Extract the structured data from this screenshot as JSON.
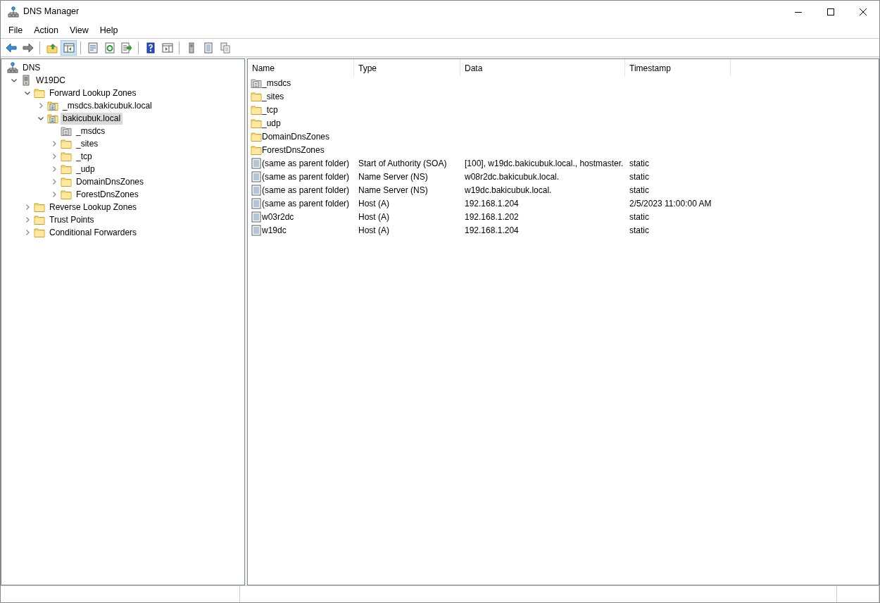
{
  "window": {
    "title": "DNS Manager"
  },
  "menu": [
    "File",
    "Action",
    "View",
    "Help"
  ],
  "toolbar": [
    [
      {
        "kind": "back",
        "pressed": false
      },
      {
        "kind": "forward",
        "pressed": false
      }
    ],
    [
      {
        "kind": "up",
        "pressed": false
      },
      {
        "kind": "tree-toggle",
        "pressed": true
      }
    ],
    [
      {
        "kind": "properties",
        "pressed": false
      },
      {
        "kind": "refresh",
        "pressed": false
      },
      {
        "kind": "export",
        "pressed": false
      }
    ],
    [
      {
        "kind": "help",
        "pressed": false
      },
      {
        "kind": "action-pane",
        "pressed": false
      }
    ],
    [
      {
        "kind": "server",
        "pressed": false
      },
      {
        "kind": "records",
        "pressed": false
      },
      {
        "kind": "copy",
        "pressed": false
      }
    ]
  ],
  "tree": [
    {
      "label": "DNS",
      "kind": "dns",
      "selected": false,
      "children": [
        {
          "label": "W19DC",
          "kind": "server",
          "expanded": true,
          "selected": false,
          "children": [
            {
              "label": "Forward Lookup Zones",
              "kind": "folder",
              "expanded": true,
              "selected": false,
              "children": [
                {
                  "label": "_msdcs.bakicubuk.local",
                  "kind": "zone",
                  "expanded": false,
                  "selected": false
                },
                {
                  "label": "bakicubuk.local",
                  "kind": "zone",
                  "expanded": true,
                  "selected": true,
                  "children": [
                    {
                      "label": "_msdcs",
                      "kind": "delegation",
                      "selected": false
                    },
                    {
                      "label": "_sites",
                      "kind": "folder",
                      "expanded": false,
                      "selected": false
                    },
                    {
                      "label": "_tcp",
                      "kind": "folder",
                      "expanded": false,
                      "selected": false
                    },
                    {
                      "label": "_udp",
                      "kind": "folder",
                      "expanded": false,
                      "selected": false
                    },
                    {
                      "label": "DomainDnsZones",
                      "kind": "folder",
                      "expanded": false,
                      "selected": false
                    },
                    {
                      "label": "ForestDnsZones",
                      "kind": "folder",
                      "expanded": false,
                      "selected": false
                    }
                  ]
                }
              ]
            },
            {
              "label": "Reverse Lookup Zones",
              "kind": "folder",
              "expanded": false,
              "selected": false
            },
            {
              "label": "Trust Points",
              "kind": "folder",
              "expanded": false,
              "selected": false
            },
            {
              "label": "Conditional Forwarders",
              "kind": "folder",
              "expanded": false,
              "selected": false
            }
          ]
        }
      ]
    }
  ],
  "table": {
    "columns": [
      "Name",
      "Type",
      "Data",
      "Timestamp"
    ],
    "rows": [
      {
        "kind": "delegation",
        "name": "_msdcs"
      },
      {
        "kind": "folder",
        "name": "_sites"
      },
      {
        "kind": "folder",
        "name": "_tcp"
      },
      {
        "kind": "folder",
        "name": "_udp"
      },
      {
        "kind": "folder",
        "name": "DomainDnsZones"
      },
      {
        "kind": "folder",
        "name": "ForestDnsZones"
      },
      {
        "kind": "record",
        "name": "(same as parent folder)",
        "type": "Start of Authority (SOA)",
        "data": "[100], w19dc.bakicubuk.local., hostmaster.",
        "timestamp": "static"
      },
      {
        "kind": "record",
        "name": "(same as parent folder)",
        "type": "Name Server (NS)",
        "data": "w08r2dc.bakicubuk.local.",
        "timestamp": "static"
      },
      {
        "kind": "record",
        "name": "(same as parent folder)",
        "type": "Name Server (NS)",
        "data": "w19dc.bakicubuk.local.",
        "timestamp": "static"
      },
      {
        "kind": "record",
        "name": "(same as parent folder)",
        "type": "Host (A)",
        "data": "192.168.1.204",
        "timestamp": "2/5/2023 11:00:00 AM"
      },
      {
        "kind": "record",
        "name": "w03r2dc",
        "type": "Host (A)",
        "data": "192.168.1.202",
        "timestamp": "static"
      },
      {
        "kind": "record",
        "name": "w19dc",
        "type": "Host (A)",
        "data": "192.168.1.204",
        "timestamp": "static"
      }
    ]
  }
}
